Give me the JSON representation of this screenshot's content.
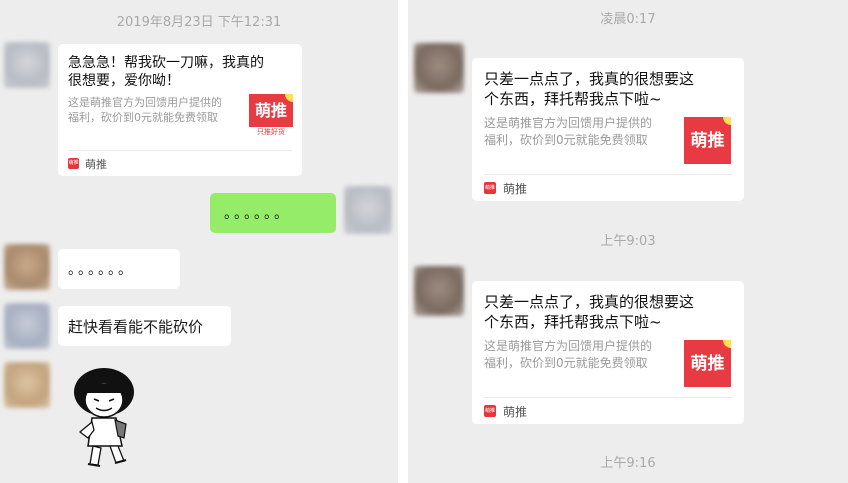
{
  "left": {
    "timestamp": "2019年8月23日 下午12:31",
    "card": {
      "title_line1": "急急急！帮我砍一刀嘛，我真的",
      "title_line2": "很想要，爱你呦！",
      "desc_line1": "这是萌推官方为回馈用户提供的",
      "desc_line2": "福利，砍价到0元就能免费领取",
      "thumb_text": "萌推",
      "thumb_sub": "只推好货",
      "source_logo": "萌推",
      "source_name": "萌推"
    },
    "sent_message": "。。。。。。",
    "reply_dots": "。。。。。。",
    "reply_text": "赶快看看能不能砍价"
  },
  "right": {
    "timestamps": [
      "凌晨0:17",
      "上午9:03",
      "上午9:16"
    ],
    "cards": [
      {
        "title_line1": "只差一点点了，我真的很想要这",
        "title_line2": "个东西，拜托帮我点下啦~",
        "desc_line1": "这是萌推官方为回馈用户提供的",
        "desc_line2": "福利，砍价到0元就能免费领取",
        "thumb_text": "萌推",
        "source_logo": "萌推",
        "source_name": "萌推"
      },
      {
        "title_line1": "只差一点点了，我真的很想要这",
        "title_line2": "个东西，拜托帮我点下啦~",
        "desc_line1": "这是萌推官方为回馈用户提供的",
        "desc_line2": "福利，砍价到0元就能免费领取",
        "thumb_text": "萌推",
        "source_logo": "萌推",
        "source_name": "萌推"
      }
    ]
  }
}
